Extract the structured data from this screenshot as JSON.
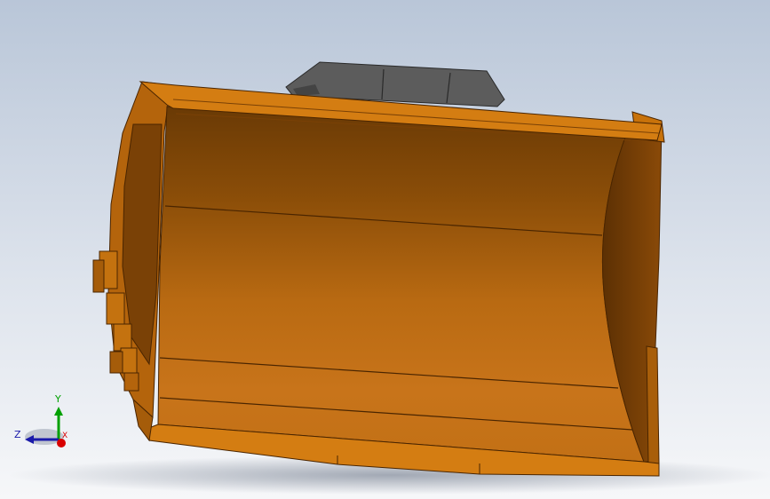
{
  "viewport": {
    "background_top": "#b9c6d8",
    "background_bottom": "#f6f7f9",
    "model": {
      "name": "loader-bucket",
      "body_color": "#c8720a",
      "edge_color": "#5a2e00",
      "bracket_color": "#5c5c5c"
    },
    "triad": {
      "x_label": "X",
      "y_label": "Y",
      "z_label": "Z",
      "x_color": "#d80000",
      "y_color": "#00a000",
      "z_color": "#1a1aaa"
    }
  }
}
